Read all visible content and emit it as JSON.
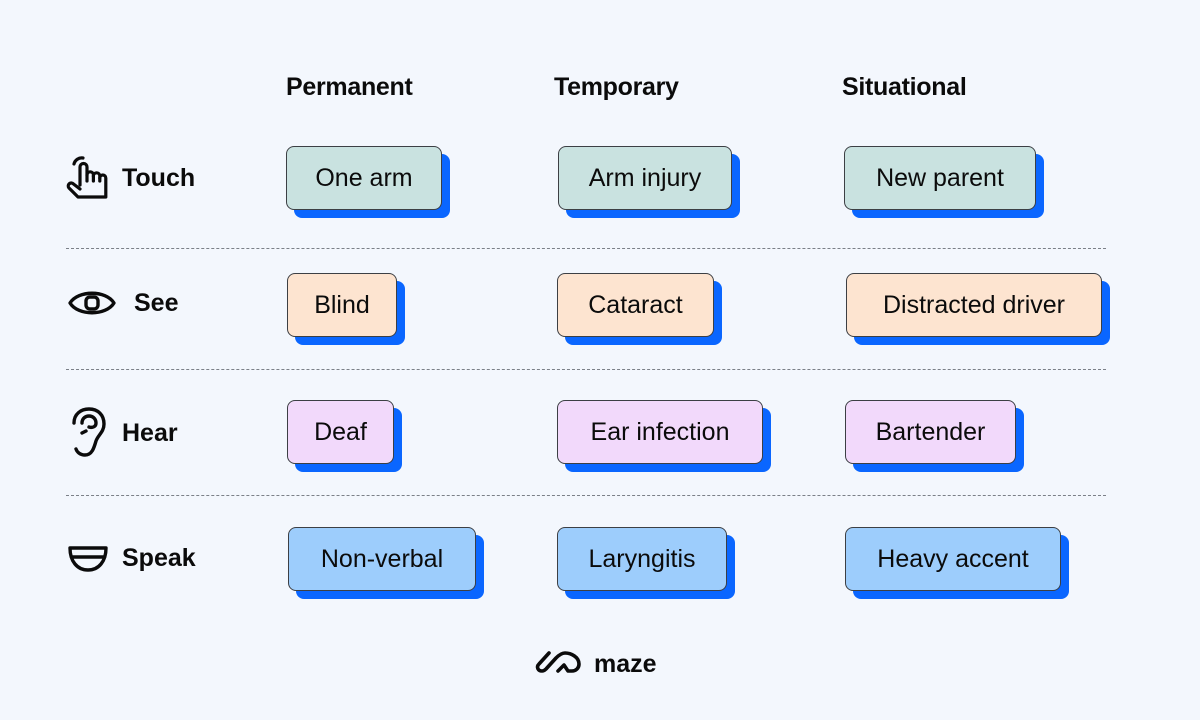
{
  "columns": [
    "Permanent",
    "Temporary",
    "Situational"
  ],
  "rows": [
    {
      "label": "Touch",
      "icon": "pointing-hand-icon",
      "color": "#c9e2e0",
      "cells": [
        "One arm",
        "Arm injury",
        "New parent"
      ]
    },
    {
      "label": "See",
      "icon": "eye-icon",
      "color": "#fde4d0",
      "cells": [
        "Blind",
        "Cataract",
        "Distracted driver"
      ]
    },
    {
      "label": "Hear",
      "icon": "ear-icon",
      "color": "#f2d9fb",
      "cells": [
        "Deaf",
        "Ear infection",
        "Bartender"
      ]
    },
    {
      "label": "Speak",
      "icon": "mouth-icon",
      "color": "#9dcdfc",
      "cells": [
        "Non-verbal",
        "Laryngitis",
        "Heavy accent"
      ]
    }
  ],
  "shadow_color": "#0a66ff",
  "brand": {
    "name": "maze",
    "icon": "maze-logo-icon"
  }
}
